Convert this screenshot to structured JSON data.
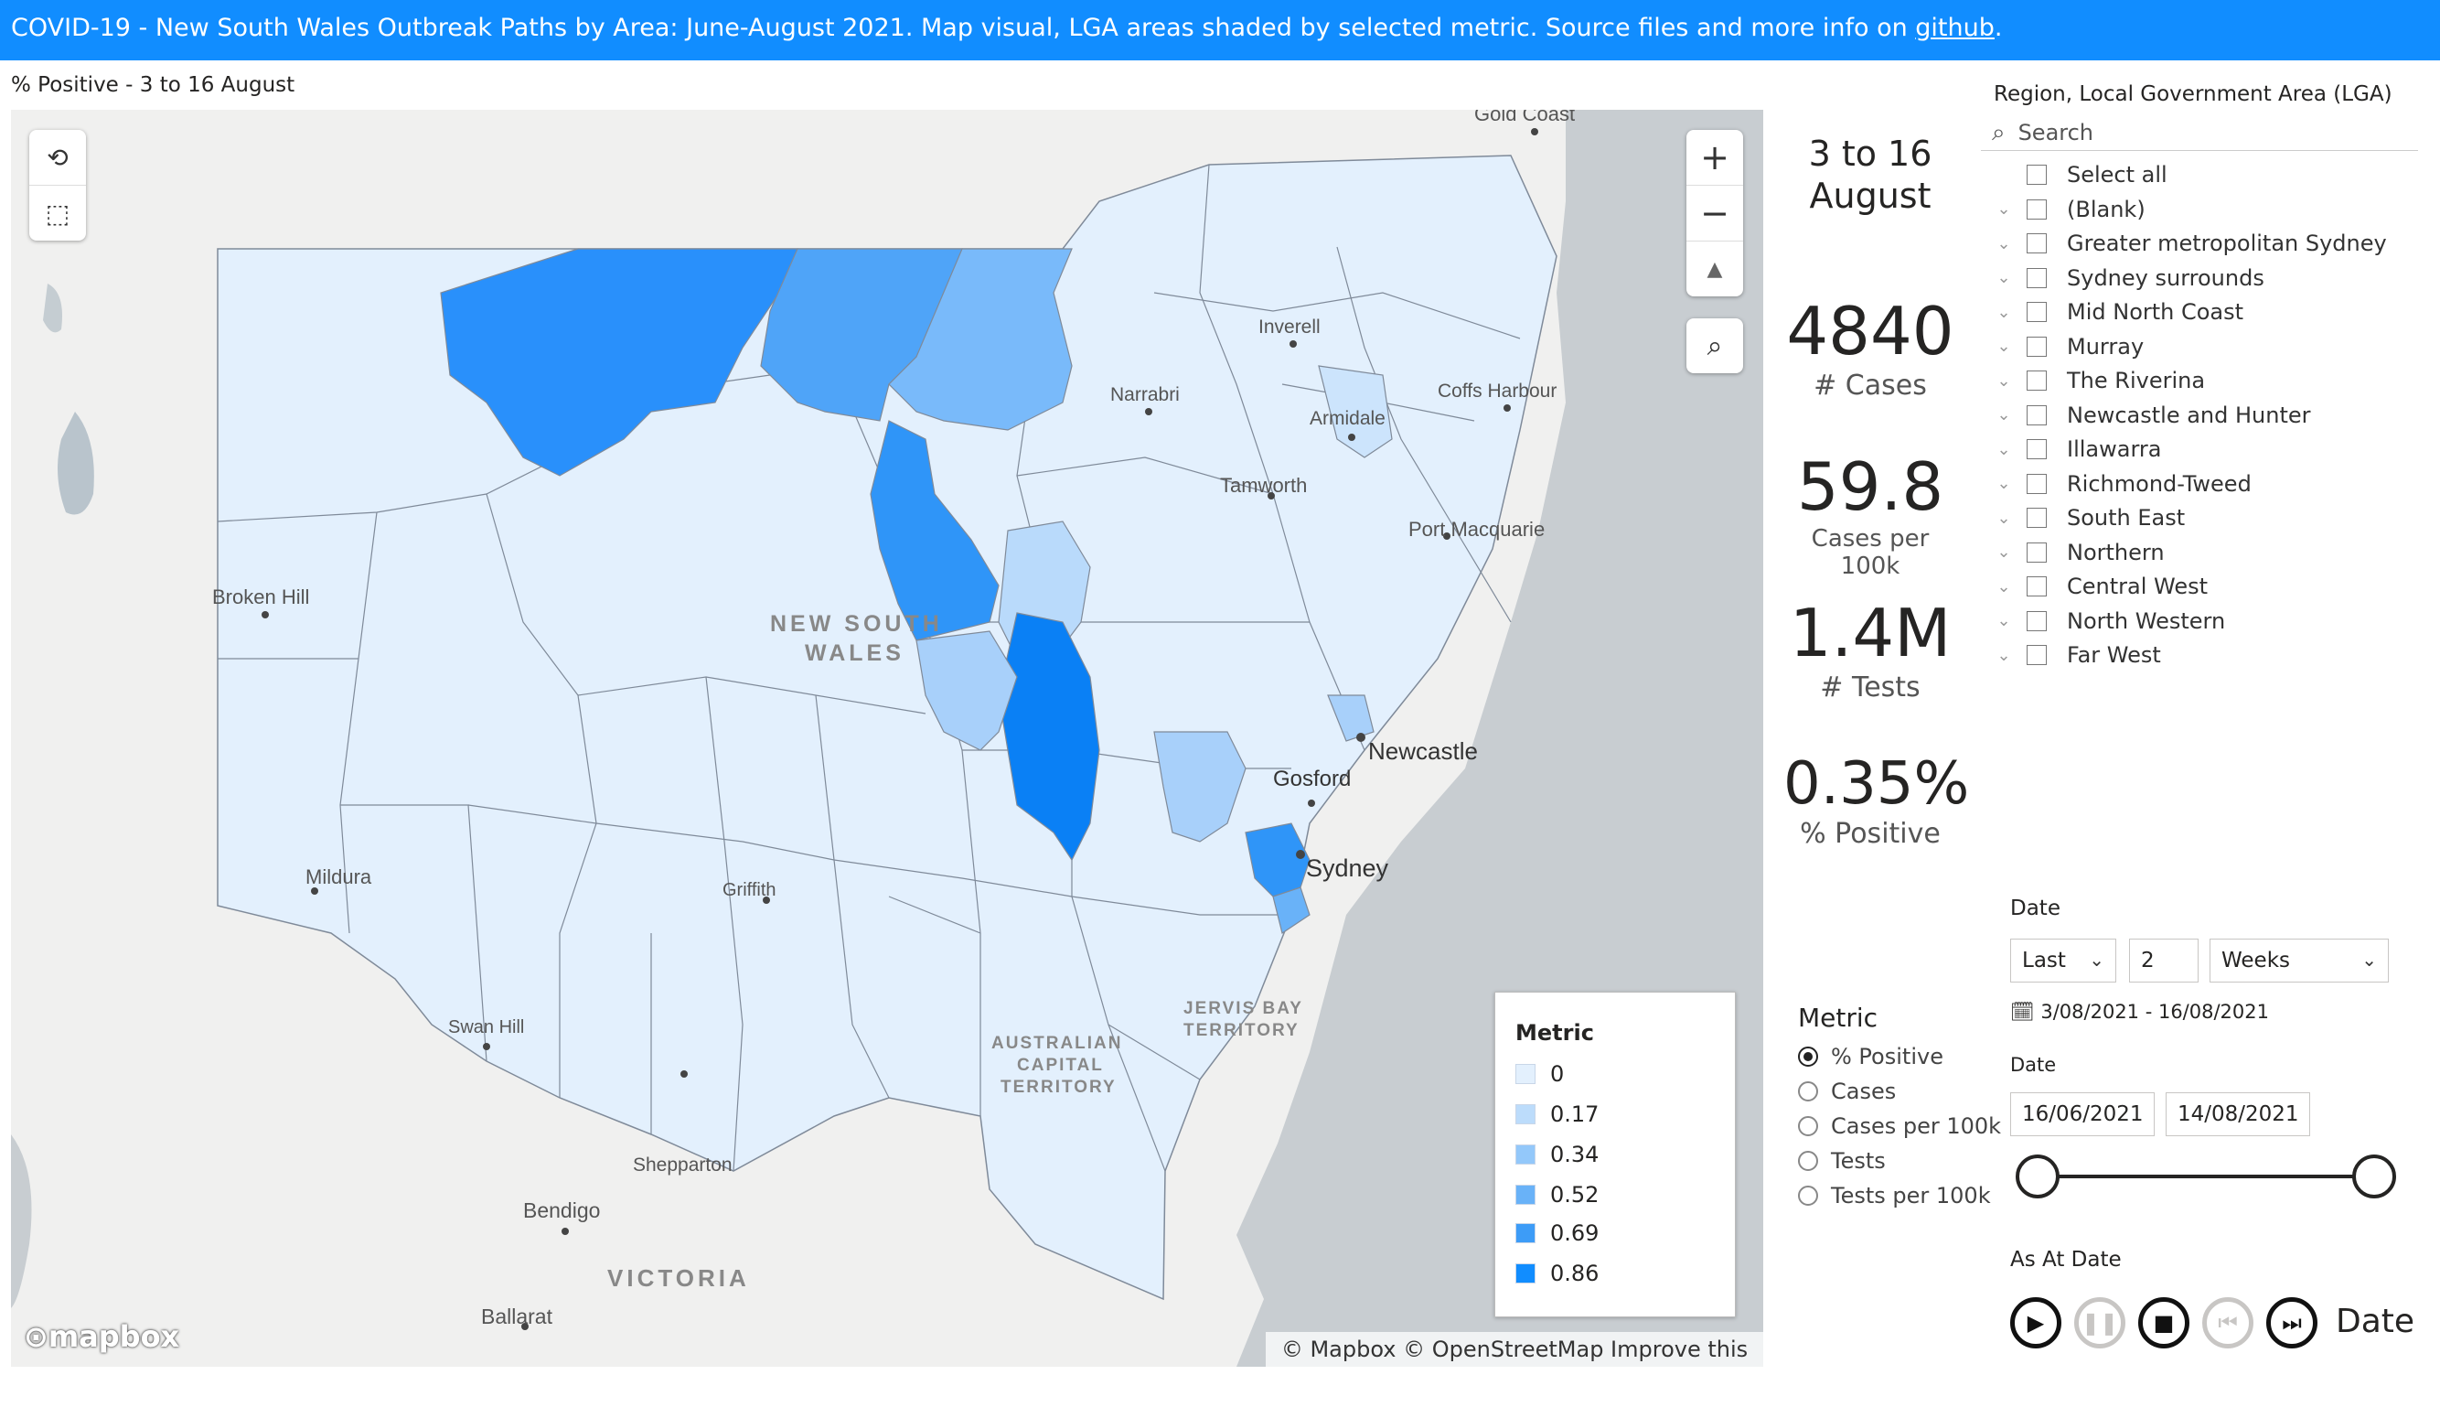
{
  "banner": {
    "text": "COVID-19  - New South Wales Outbreak Paths by Area: June-August 2021.  Map visual, LGA areas shaded by selected metric. Source files and more info on ",
    "link": "github",
    "suffix": ".",
    "color": "#118dff"
  },
  "map": {
    "title": "% Positive - 3 to 16 August",
    "place_labels": [
      "Gold Coast",
      "Inverell",
      "Coffs Harbour",
      "Narrabri",
      "Armidale",
      "Tamworth",
      "Port Macquarie",
      "Broken Hill",
      "NEW SOUTH",
      "WALES",
      "Newcastle",
      "Gosford",
      "Sydney",
      "Mildura",
      "Griffith",
      "JERVIS BAY",
      "TERRITORY",
      "AUSTRALIAN",
      "CAPITAL",
      "TERRITORY",
      "Swan Hill",
      "Shepparton",
      "Bendigo",
      "VICTORIA",
      "Ballarat"
    ],
    "controls": {
      "zoom_in": "+",
      "zoom_out": "−",
      "compass": "▲"
    },
    "attribution": "© Mapbox © OpenStreetMap Improve this map",
    "logo": "mapbox",
    "legend": {
      "title": "Metric",
      "items": [
        {
          "label": "0",
          "color": "#e3f0fd"
        },
        {
          "label": "0.17",
          "color": "#bcdcfb"
        },
        {
          "label": "0.34",
          "color": "#93c8fa"
        },
        {
          "label": "0.52",
          "color": "#69b2f8"
        },
        {
          "label": "0.69",
          "color": "#3d9cf7"
        },
        {
          "label": "0.86",
          "color": "#118dff"
        }
      ]
    }
  },
  "kpis": {
    "period": "3 to 16 August",
    "cases": "4840",
    "cases_label": "# Cases",
    "cases_per_100k": "59.8",
    "cases_per_100k_label": "Cases per 100k",
    "tests": "1.4M",
    "tests_label": "# Tests",
    "positive": "0.35%",
    "positive_label": "% Positive"
  },
  "slicer": {
    "title": "Region, Local Government Area (LGA)",
    "search_placeholder": "Search",
    "items": [
      "Select all",
      "(Blank)",
      "Greater metropolitan Sydney",
      "Sydney surrounds",
      "Mid North Coast",
      "Murray",
      "The Riverina",
      "Newcastle and Hunter",
      "Illawarra",
      "Richmond-Tweed",
      "South East",
      "Northern",
      "Central West",
      "North Western",
      "Far West"
    ]
  },
  "metric": {
    "title": "Metric",
    "options": [
      "% Positive",
      "Cases",
      "Cases per 100k",
      "Tests",
      "Tests per 100k"
    ],
    "selected": "% Positive"
  },
  "date_filter": {
    "label": "Date",
    "mode": "Last",
    "count": "2",
    "unit": "Weeks",
    "range_text": "3/08/2021 - 16/08/2021",
    "label2": "Date",
    "start": "16/06/2021",
    "end": "14/08/2021",
    "slider_start_fraction": 0,
    "slider_end_fraction": 1
  },
  "playback": {
    "title": "As At Date",
    "field": "Date"
  }
}
